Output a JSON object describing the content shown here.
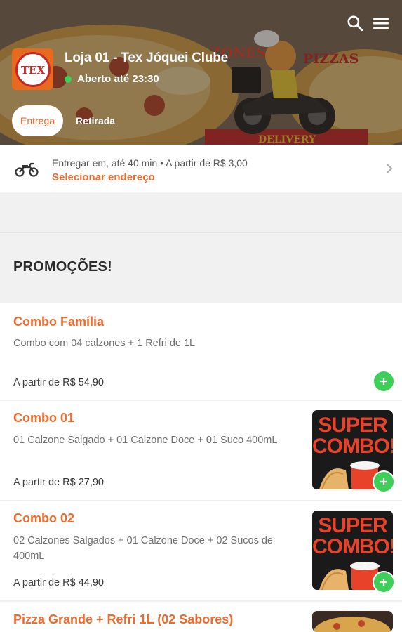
{
  "header": {
    "store_name": "Loja 01 - Tex Jóquei Clube",
    "status_text": "Aberto até 23:30",
    "status_color": "#3ccf5d",
    "logo_text": "TEX",
    "icons": {
      "search": "search-icon",
      "menu": "hamburger-menu-icon"
    },
    "tabs": [
      {
        "label": "Entrega",
        "active": true
      },
      {
        "label": "Retirada",
        "active": false
      }
    ]
  },
  "delivery": {
    "info": "Entregar em, até 40 min  •  A partir de R$ 3,00",
    "action": "Selecionar endereço",
    "icon": "motorcycle-icon"
  },
  "section": {
    "title": "PROMOÇÕES!"
  },
  "products": [
    {
      "name": "Combo Família",
      "description": "Combo com 04 calzones + 1 Refri de 1L",
      "price_prefix": "A partir de",
      "price": "R$ 54,90"
    },
    {
      "name": "Combo 01",
      "description": "01 Calzone Salgado + 01 Calzone Doce + 01 Suco 400mL",
      "price_prefix": "A partir de",
      "price": "R$ 27,90",
      "image_text": [
        "SUPER",
        "COMBO!"
      ]
    },
    {
      "name": "Combo 02",
      "description": "02 Calzones Salgados + 01 Calzone Doce + 02 Sucos de 400mL",
      "price_prefix": "A partir de",
      "price": "R$ 44,90",
      "image_text": [
        "SUPER",
        "COMBO!"
      ]
    },
    {
      "name": "Pizza Grande + Refri 1L (02 Sabores)"
    }
  ],
  "colors": {
    "accent": "#ee6b2e",
    "add_button": "#3ecf59"
  }
}
